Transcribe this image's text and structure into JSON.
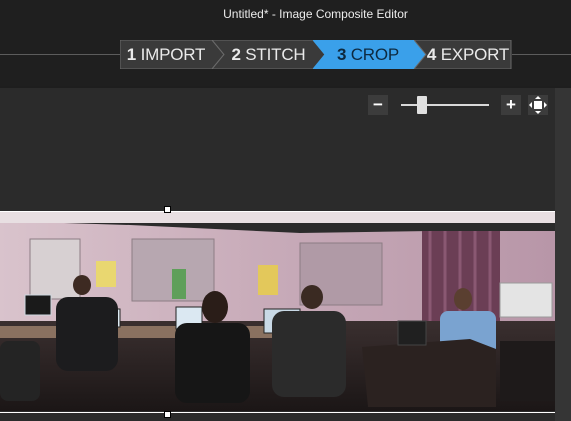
{
  "window": {
    "title": "Untitled* - Image Composite Editor"
  },
  "steps": [
    {
      "number": "1",
      "label": "IMPORT",
      "active": false
    },
    {
      "number": "2",
      "label": "STITCH",
      "active": false
    },
    {
      "number": "3",
      "label": "CROP",
      "active": true
    },
    {
      "number": "4",
      "label": "EXPORT",
      "active": false
    }
  ],
  "zoom": {
    "out_symbol": "−",
    "in_symbol": "+",
    "level": 0.2
  },
  "colors": {
    "active_step": "#3aa0ea",
    "inactive_step": "#3a3a3a",
    "workspace": "#2b2b2b",
    "chrome": "#1f1f1f"
  },
  "icons": {
    "zoom_out": "minus-icon",
    "zoom_in": "plus-icon",
    "fit": "fit-to-window-icon"
  }
}
